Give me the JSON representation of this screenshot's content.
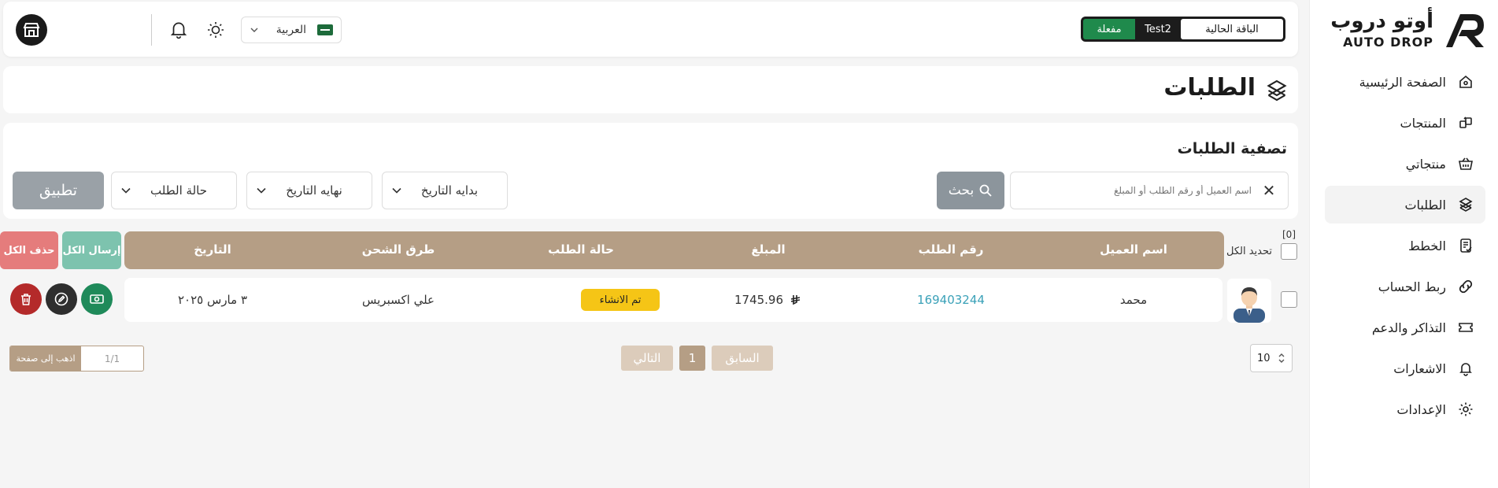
{
  "brand": {
    "name_ar": "أوتو دروب",
    "name_en": "AUTO DROP"
  },
  "sidebar": {
    "items": [
      {
        "label": "الصفحة الرئيسية",
        "icon": "home-icon"
      },
      {
        "label": "المنتجات",
        "icon": "products-icon"
      },
      {
        "label": "منتجاتي",
        "icon": "basket-icon"
      },
      {
        "label": "الطلبات",
        "icon": "orders-icon",
        "active": true
      },
      {
        "label": "الخطط",
        "icon": "plans-icon"
      },
      {
        "label": "ربط الحساب",
        "icon": "link-icon"
      },
      {
        "label": "التذاكر والدعم",
        "icon": "ticket-icon"
      },
      {
        "label": "الاشعارات",
        "icon": "bell-icon"
      },
      {
        "label": "الإعدادات",
        "icon": "gear-icon"
      }
    ]
  },
  "header": {
    "plan_label": "الباقة الحالية",
    "plan_name": "Test2",
    "plan_status": "مفعلة",
    "language": "العربية"
  },
  "page": {
    "title": "الطلبات"
  },
  "filter": {
    "title": "تصفية الطلبات",
    "search_placeholder": "اسم العميل أو رقم الطلب أو المبلغ",
    "search_button": "بحث",
    "start_date": "بدايه التاريخ",
    "end_date": "نهايه التاريخ",
    "order_status": "حالة الطلب",
    "apply": "تطبيق"
  },
  "table": {
    "selected_count": "[0]",
    "select_all": "تحديد الكل",
    "send_all": "إرسال الكل",
    "delete_all": "حذف الكل",
    "headers": {
      "customer": "اسم العميل",
      "order_number": "رقم الطلب",
      "amount": "المبلغ",
      "status": "حالة الطلب",
      "shipping": "طرق الشحن",
      "date": "التاريخ"
    },
    "rows": [
      {
        "customer": "محمد",
        "order_number": "169403244",
        "amount": "1745.96",
        "status": "تم الانشاء",
        "shipping": "علي اكسبريس",
        "date": "٣ مارس ٢٠٢٥"
      }
    ]
  },
  "pagination": {
    "per_page": "10",
    "prev": "السابق",
    "current": "1",
    "next": "التالي",
    "goto_label": "اذهب إلى صفحة",
    "goto_value": "1/1"
  },
  "colors": {
    "accent": "#b59e85",
    "active_plan": "#1f8a4c",
    "status_created": "#f5c516",
    "link": "#3aa1b8"
  }
}
